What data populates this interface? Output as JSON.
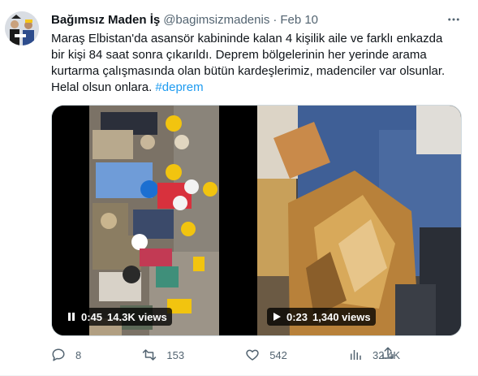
{
  "tweet": {
    "display_name": "Bağımsız Maden İş",
    "handle": "@bagimsizmadenis",
    "separator": "·",
    "date": "Feb 10",
    "text_lines": [
      "Maraş Elbistan'da asansör kabininde kalan 4 kişilik aile ve farklı enkazda",
      "bir kişi 84 saat sonra çıkarıldı. Deprem bölgelerinin her yerinde arama",
      "kurtarma çalışmasında olan bütün kardeşlerimiz, madenciler var olsunlar.",
      "Helal olsun onlara."
    ],
    "hashtag": "#deprem",
    "more_icon": "more-horizontal-icon"
  },
  "videos": [
    {
      "time": "0:45",
      "views": "14.3K views",
      "state_icon": "pause-icon"
    },
    {
      "time": "0:23",
      "views": "1,340 views",
      "state_icon": "play-icon"
    }
  ],
  "actions": {
    "replies": "8",
    "retweets": "153",
    "likes": "542",
    "views": "32.4K"
  },
  "colors": {
    "accent": "#1d9bf0",
    "secondary_text": "#536471",
    "primary_text": "#0f1419"
  }
}
